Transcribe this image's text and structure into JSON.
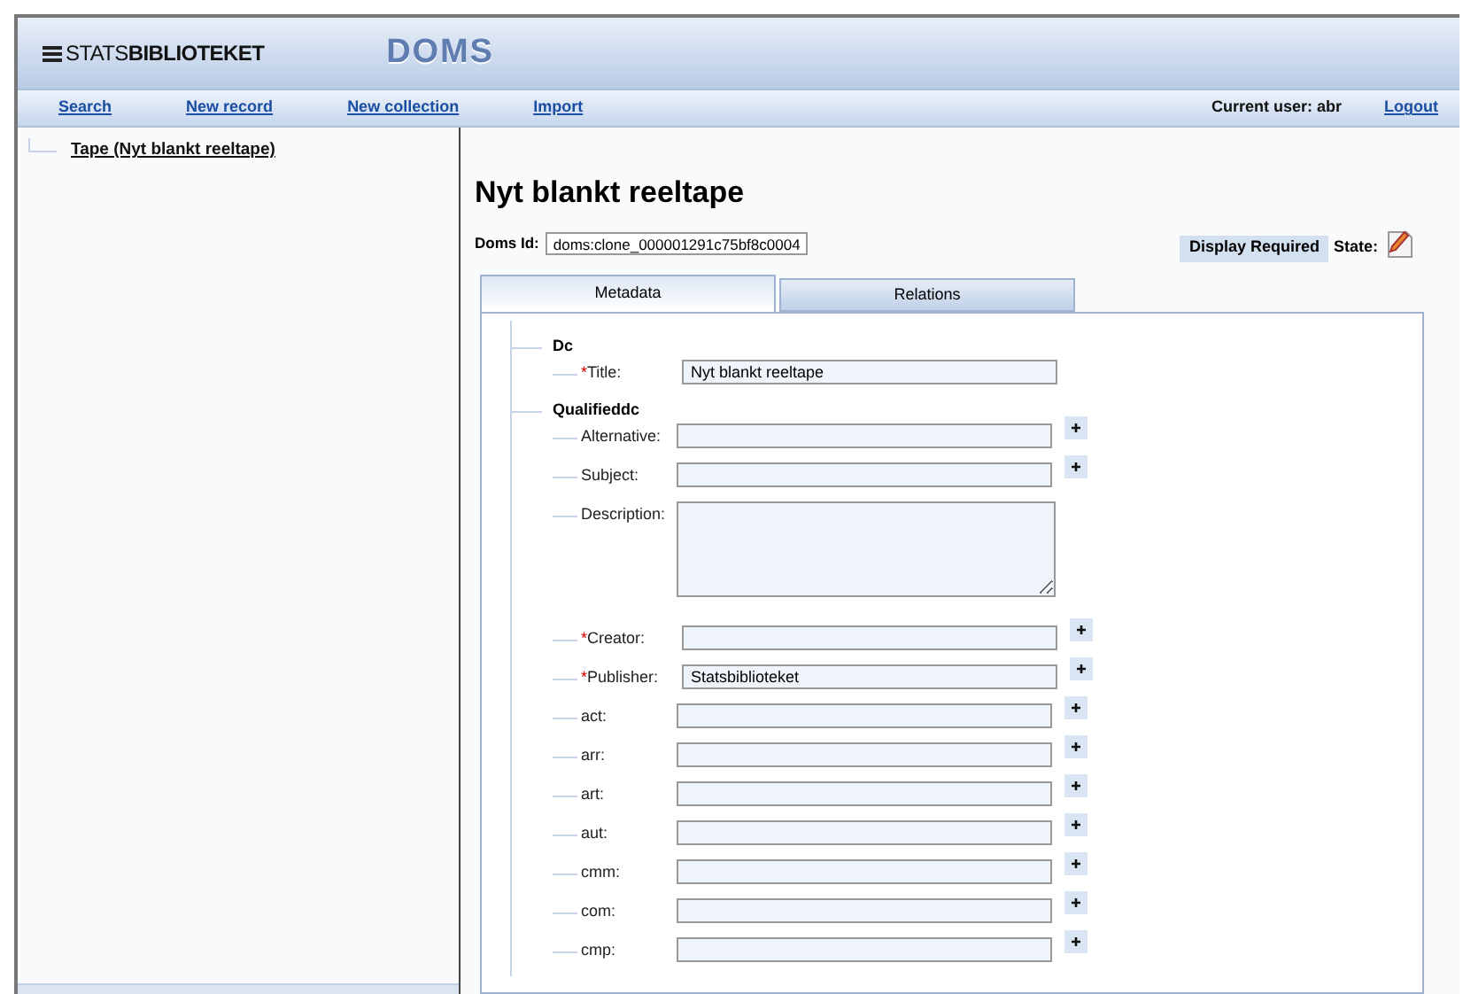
{
  "header": {
    "logo_light": "STATS",
    "logo_bold": "BIBLIOTEKET",
    "app_name": "DOMS"
  },
  "nav": {
    "links": [
      "Search",
      "New record",
      "New collection",
      "Import"
    ],
    "current_user": "Current user: abr",
    "logout": "Logout"
  },
  "tree": [
    {
      "label": "Tape (Nyt blankt reeltape)",
      "selected": true
    }
  ],
  "record": {
    "title": "Nyt blankt reeltape",
    "id_label": "Doms Id:",
    "id_value": "doms:clone_000001291c75bf8c0004",
    "display_required": "Display Required",
    "state_label": "State:"
  },
  "tabs": [
    {
      "label": "Metadata",
      "selected": true
    },
    {
      "label": "Relations",
      "selected": false
    }
  ],
  "sections": [
    {
      "heading": "Dc",
      "fields": [
        {
          "kind": "text",
          "marker": "*",
          "label": "Title:",
          "value": "Nyt blankt reeltape",
          "add": false
        }
      ]
    },
    {
      "heading": "Qualifieddc",
      "fields": [
        {
          "kind": "text",
          "label": "Alternative:",
          "add": true
        },
        {
          "kind": "text",
          "label": "Subject:",
          "add": true
        },
        {
          "kind": "textarea",
          "label": "Description:",
          "add": false
        },
        {
          "kind": "text",
          "marker": "*",
          "label": "Creator:",
          "add": true
        },
        {
          "kind": "text",
          "marker": "*",
          "label": "Publisher:",
          "value": "Statsbiblioteket",
          "add": true
        },
        {
          "kind": "text",
          "label": "act:",
          "add": true
        },
        {
          "kind": "text",
          "label": "arr:",
          "add": true
        },
        {
          "kind": "text",
          "label": "art:",
          "add": true
        },
        {
          "kind": "text",
          "label": "aut:",
          "add": true
        },
        {
          "kind": "text",
          "label": "cmm:",
          "add": true
        },
        {
          "kind": "text",
          "label": "com:",
          "add": true
        },
        {
          "kind": "text",
          "label": "cmp:",
          "add": true
        }
      ]
    }
  ]
}
